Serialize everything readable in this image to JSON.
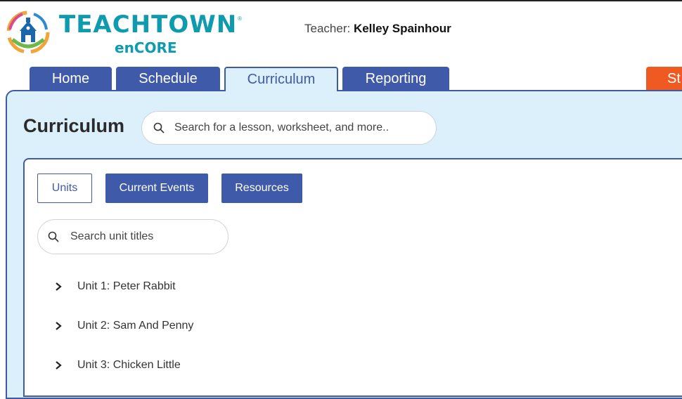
{
  "header": {
    "brand": "TEACHTOWN",
    "brand_mark": "®",
    "sub_brand": "enCORE",
    "teacher_label": "Teacher:",
    "teacher_name": "Kelley Spainhour"
  },
  "tabs": [
    {
      "label": "Home"
    },
    {
      "label": "Schedule"
    },
    {
      "label": "Curriculum"
    },
    {
      "label": "Reporting"
    },
    {
      "label": "St"
    }
  ],
  "page": {
    "title": "Curriculum",
    "search_placeholder": "Search for a lesson, worksheet, and more.."
  },
  "filters": [
    {
      "label": "Units"
    },
    {
      "label": "Current Events"
    },
    {
      "label": "Resources"
    }
  ],
  "unit_search": {
    "placeholder": "Search unit titles"
  },
  "units": [
    {
      "label": "Unit 1: Peter Rabbit"
    },
    {
      "label": "Unit 2: Sam And Penny"
    },
    {
      "label": "Unit 3: Chicken Little"
    }
  ],
  "colors": {
    "brand": "#0e9bb0",
    "tab_dark": "#3f5aa8",
    "panel_bg": "#dbf0fb",
    "accent_orange": "#ef5a22"
  },
  "icons": {
    "logo": "schoolhouse-logo-icon",
    "search": "search-icon",
    "expand": "chevron-right-icon"
  }
}
